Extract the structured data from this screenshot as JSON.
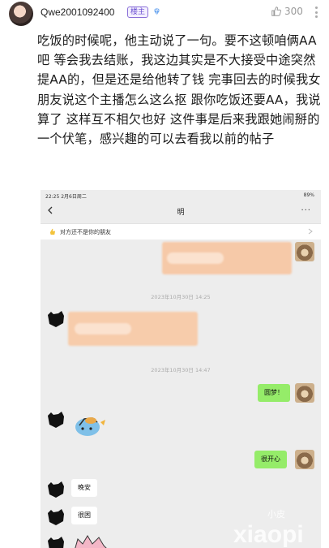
{
  "post": {
    "username": "Qwe2001092400",
    "badge": "楼主",
    "likes": "300",
    "body": "吃饭的时候呢，他主动说了一句。要不这顿咱俩AA吧 等会我去结账，我这边其实是不大接受中途突然提AA的，但是还是给他转了钱 完事回去的时候我女朋友说这个主播怎么这么抠 跟你吃饭还要AA，我说算了 这样互不相欠也好 这件事是后来我跟她闹掰的一个伏笔，感兴趣的可以去看我以前的帖子"
  },
  "screenshot": {
    "status_time": "22:25  2月6日周二",
    "status_battery": "89%",
    "chat_title": "明",
    "notice": "对方还不是你的朋友",
    "timestamp_1": "2023年10月30日 14:25",
    "timestamp_2": "2023年10月30日 14:47",
    "msg_1": "圆梦！",
    "msg_2": "很开心",
    "msg_3": "晚安",
    "msg_4": "很困"
  },
  "watermark": {
    "top": "小皮",
    "main": "xiaopi"
  },
  "colors": {
    "green_bubble": "#95ec69",
    "badge_purple": "#6b4fd0",
    "redacted_orange": "#f6c9a8"
  }
}
